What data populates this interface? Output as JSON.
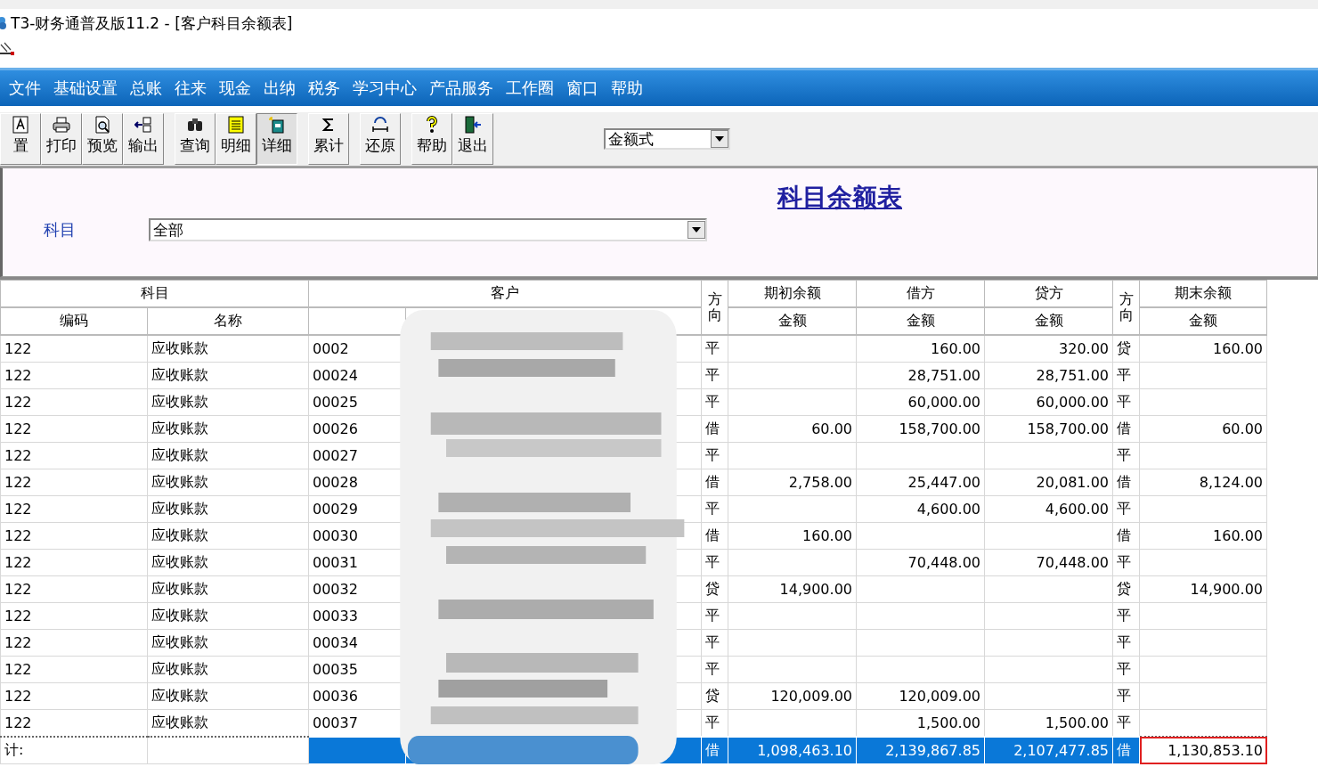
{
  "window": {
    "title": "T3-财务通普及版11.2 - [客户科目余额表]"
  },
  "menu": [
    "文件",
    "基础设置",
    "总账",
    "往来",
    "现金",
    "出纳",
    "税务",
    "学习中心",
    "产品服务",
    "工作圈",
    "窗口",
    "帮助"
  ],
  "toolbar_groups": [
    [
      {
        "label": "置",
        "kind": "font",
        "selected": false
      },
      {
        "label": "打印",
        "kind": "printer",
        "selected": false
      },
      {
        "label": "预览",
        "kind": "preview",
        "selected": false
      },
      {
        "label": "输出",
        "kind": "export",
        "selected": false
      }
    ],
    [
      {
        "label": "查询",
        "kind": "binoculars",
        "selected": false
      },
      {
        "label": "明细",
        "kind": "list",
        "selected": false
      },
      {
        "label": "详细",
        "kind": "book",
        "selected": true
      }
    ],
    [
      {
        "label": "累计",
        "kind": "sigma",
        "selected": false
      }
    ],
    [
      {
        "label": "还原",
        "kind": "restore",
        "selected": false
      }
    ],
    [
      {
        "label": "帮助",
        "kind": "help",
        "selected": false
      },
      {
        "label": "退出",
        "kind": "exit",
        "selected": false
      }
    ]
  ],
  "format_select": {
    "value": "金额式"
  },
  "report": {
    "title": "科目余额表",
    "subject_label": "科目",
    "subject_value": "全部"
  },
  "table": {
    "group_headers": [
      "科目",
      "客户",
      "方向",
      "期初余额",
      "借方",
      "贷方",
      "方向",
      "期末余额"
    ],
    "sub_headers": [
      "编码",
      "名称",
      "金额",
      "金额",
      "金额",
      "金额"
    ],
    "rows": [
      {
        "code": "122",
        "name": "应收账款",
        "customer_code": "0002",
        "dir": "平",
        "debit": "160.00",
        "credit": "320.00",
        "end_dir": "贷",
        "closing": "160.00"
      },
      {
        "code": "122",
        "name": "应收账款",
        "customer_code": "00024",
        "dir": "平",
        "debit": "28,751.00",
        "credit": "28,751.00",
        "end_dir": "平"
      },
      {
        "code": "122",
        "name": "应收账款",
        "customer_code": "00025",
        "dir": "平",
        "debit": "60,000.00",
        "credit": "60,000.00",
        "end_dir": "平"
      },
      {
        "code": "122",
        "name": "应收账款",
        "customer_code": "00026",
        "dir": "借",
        "opening": "60.00",
        "debit": "158,700.00",
        "credit": "158,700.00",
        "end_dir": "借",
        "closing": "60.00"
      },
      {
        "code": "122",
        "name": "应收账款",
        "customer_code": "00027",
        "dir": "平",
        "end_dir": "平"
      },
      {
        "code": "122",
        "name": "应收账款",
        "customer_code": "00028",
        "dir": "借",
        "opening": "2,758.00",
        "debit": "25,447.00",
        "credit": "20,081.00",
        "end_dir": "借",
        "closing": "8,124.00"
      },
      {
        "code": "122",
        "name": "应收账款",
        "customer_code": "00029",
        "dir": "平",
        "debit": "4,600.00",
        "credit": "4,600.00",
        "end_dir": "平"
      },
      {
        "code": "122",
        "name": "应收账款",
        "customer_code": "00030",
        "dir": "借",
        "opening": "160.00",
        "end_dir": "借",
        "closing": "160.00"
      },
      {
        "code": "122",
        "name": "应收账款",
        "customer_code": "00031",
        "dir": "平",
        "debit": "70,448.00",
        "credit": "70,448.00",
        "end_dir": "平"
      },
      {
        "code": "122",
        "name": "应收账款",
        "customer_code": "00032",
        "dir": "贷",
        "opening": "14,900.00",
        "end_dir": "贷",
        "closing": "14,900.00"
      },
      {
        "code": "122",
        "name": "应收账款",
        "customer_code": "00033",
        "dir": "平",
        "end_dir": "平"
      },
      {
        "code": "122",
        "name": "应收账款",
        "customer_code": "00034",
        "dir": "平",
        "end_dir": "平"
      },
      {
        "code": "122",
        "name": "应收账款",
        "customer_code": "00035",
        "dir": "平",
        "end_dir": "平"
      },
      {
        "code": "122",
        "name": "应收账款",
        "customer_code": "00036",
        "dir": "贷",
        "opening": "120,009.00",
        "debit": "120,009.00",
        "end_dir": "平"
      },
      {
        "code": "122",
        "name": "应收账款",
        "customer_code": "00037",
        "dir": "平",
        "debit": "1,500.00",
        "credit": "1,500.00",
        "end_dir": "平"
      }
    ],
    "total": {
      "label": "计:",
      "dir": "借",
      "opening": "1,098,463.10",
      "debit": "2,139,867.85",
      "credit": "2,107,477.85",
      "end_dir": "借",
      "closing": "1,130,853.10",
      "closing_highlighted": true
    }
  }
}
